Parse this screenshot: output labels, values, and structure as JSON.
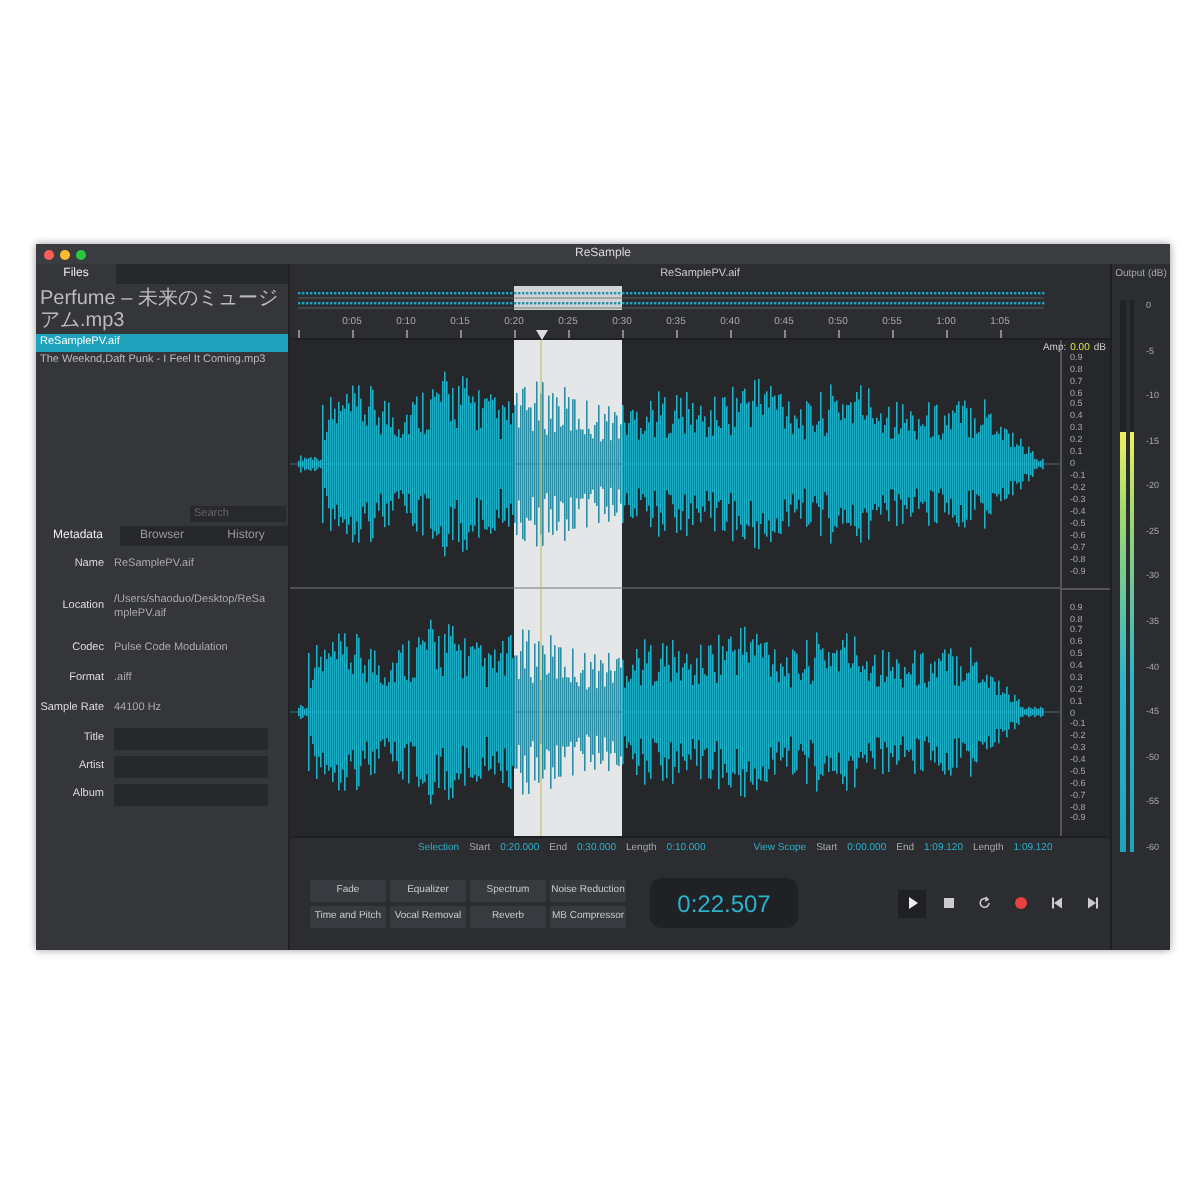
{
  "window": {
    "title": "ReSample"
  },
  "sidebar": {
    "tabs": [
      {
        "label": "Files",
        "selected": true
      }
    ],
    "files": [
      {
        "name": "Perfume – 未来のミュージアム.mp3",
        "selected": false
      },
      {
        "name": "ReSamplePV.aif",
        "selected": true
      },
      {
        "name": "The Weeknd,Daft Punk - I Feel It Coming.mp3",
        "selected": false
      }
    ],
    "search": {
      "placeholder": "Search"
    },
    "info_tabs": [
      {
        "label": "Metadata",
        "selected": true
      },
      {
        "label": "Browser",
        "selected": false
      },
      {
        "label": "History",
        "selected": false
      }
    ],
    "metadata": [
      {
        "kind": "text",
        "label": "Name",
        "value": "ReSamplePV.aif"
      },
      {
        "kind": "text",
        "label": "Location",
        "value": "/Users/shaoduo/Desktop/ReSamplePV.aif"
      },
      {
        "kind": "text",
        "label": "Codec",
        "value": "Pulse Code Modulation"
      },
      {
        "kind": "text",
        "label": "Format",
        "value": ".aiff"
      },
      {
        "kind": "text",
        "label": "Sample Rate",
        "value": "44100 Hz"
      },
      {
        "kind": "field",
        "label": "Title"
      },
      {
        "kind": "field",
        "label": "Artist"
      },
      {
        "kind": "field",
        "label": "Album"
      }
    ]
  },
  "editor": {
    "file_title": "ReSamplePV.aif",
    "ruler": [
      "0:05",
      "0:10",
      "0:15",
      "0:20",
      "0:25",
      "0:30",
      "0:35",
      "0:40",
      "0:45",
      "0:50",
      "0:55",
      "1:00",
      "1:05"
    ],
    "amp": {
      "label": "Amp:",
      "value": "0.00",
      "unit": "dB"
    },
    "channels": [
      {
        "scale": [
          "0.9",
          "0.8",
          "0.7",
          "0.6",
          "0.5",
          "0.4",
          "0.3",
          "0.2",
          "0.1",
          "0",
          "-0.1",
          "-0.2",
          "-0.3",
          "-0.4",
          "-0.5",
          "-0.6",
          "-0.7",
          "-0.8",
          "-0.9"
        ]
      },
      {
        "scale": [
          "0.9",
          "0.8",
          "0.7",
          "0.6",
          "0.5",
          "0.4",
          "0.3",
          "0.2",
          "0.1",
          "0",
          "-0.1",
          "-0.2",
          "-0.3",
          "-0.4",
          "-0.5",
          "-0.6",
          "-0.7",
          "-0.8",
          "-0.9"
        ]
      }
    ],
    "selection": {
      "label": "Selection",
      "fields": [
        {
          "label": "Start",
          "value": "0:20.000"
        },
        {
          "label": "End",
          "value": "0:30.000"
        },
        {
          "label": "Length",
          "value": "0:10.000"
        }
      ]
    },
    "view_scope": {
      "label": "View Scope",
      "fields": [
        {
          "label": "Start",
          "value": "0:00.000"
        },
        {
          "label": "End",
          "value": "1:09.120"
        },
        {
          "label": "Length",
          "value": "1:09.120"
        }
      ]
    },
    "effects": [
      "Fade",
      "Equalizer",
      "Spectrum",
      "Noise Reduction",
      "Time and Pitch",
      "Vocal Removal",
      "Reverb",
      "MB Compressor"
    ],
    "time": "0:22.507",
    "transport": [
      {
        "kind": "play",
        "selected": true
      },
      {
        "kind": "stop",
        "selected": false
      },
      {
        "kind": "loop",
        "selected": false
      },
      {
        "kind": "record",
        "selected": false
      },
      {
        "kind": "previous",
        "selected": false
      },
      {
        "kind": "next",
        "selected": false
      }
    ]
  },
  "output": {
    "title": "Output (dB)",
    "scale": [
      "0",
      "-5",
      "-10",
      "-15",
      "-20",
      "-25",
      "-30",
      "-35",
      "-40",
      "-45",
      "-50",
      "-55",
      "-60"
    ],
    "meters": [
      {
        "level": 0.76
      },
      {
        "level": 0.76
      }
    ]
  }
}
